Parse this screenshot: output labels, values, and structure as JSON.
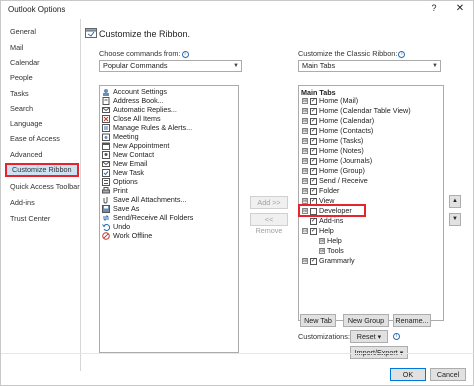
{
  "window": {
    "title": "Outlook Options",
    "help_glyph": "?",
    "close_glyph": "✕"
  },
  "sidebar": {
    "items": [
      {
        "label": "General"
      },
      {
        "label": "Mail"
      },
      {
        "label": "Calendar"
      },
      {
        "label": "People"
      },
      {
        "label": "Tasks"
      },
      {
        "label": "Search"
      },
      {
        "label": "Language"
      },
      {
        "label": "Ease of Access"
      },
      {
        "label": "Advanced"
      },
      {
        "label": "Customize Ribbon"
      },
      {
        "label": "Quick Access Toolbar"
      },
      {
        "label": "Add-ins"
      },
      {
        "label": "Trust Center"
      }
    ],
    "selected": "Customize Ribbon"
  },
  "main": {
    "heading": "Customize the Ribbon.",
    "left": {
      "label": "Choose commands from:",
      "select_value": "Popular Commands",
      "commands": [
        {
          "label": "Account Settings",
          "icon": "account-settings-icon"
        },
        {
          "label": "Address Book...",
          "icon": "address-book-icon"
        },
        {
          "label": "Automatic Replies...",
          "icon": "automatic-replies-icon"
        },
        {
          "label": "Close All Items",
          "icon": "close-all-items-icon"
        },
        {
          "label": "Manage Rules & Alerts...",
          "icon": "rules-icon"
        },
        {
          "label": "Meeting",
          "icon": "meeting-icon"
        },
        {
          "label": "New Appointment",
          "icon": "appointment-icon"
        },
        {
          "label": "New Contact",
          "icon": "contact-icon"
        },
        {
          "label": "New Email",
          "icon": "email-icon"
        },
        {
          "label": "New Task",
          "icon": "task-icon"
        },
        {
          "label": "Options",
          "icon": "options-icon"
        },
        {
          "label": "Print",
          "icon": "print-icon"
        },
        {
          "label": "Save All Attachments...",
          "icon": "attachments-icon"
        },
        {
          "label": "Save As",
          "icon": "save-as-icon"
        },
        {
          "label": "Send/Receive All Folders",
          "icon": "send-receive-icon"
        },
        {
          "label": "Undo",
          "icon": "undo-icon"
        },
        {
          "label": "Work Offline",
          "icon": "work-offline-icon"
        }
      ]
    },
    "middle": {
      "add_label": "Add >>",
      "remove_label": "<< Remove"
    },
    "right": {
      "label": "Customize the Classic Ribbon:",
      "select_value": "Main Tabs",
      "tree_header": "Main Tabs",
      "tabs": [
        {
          "label": "Home (Mail)",
          "checked": true,
          "expander": "⊞"
        },
        {
          "label": "Home (Calendar Table View)",
          "checked": true,
          "expander": "⊞"
        },
        {
          "label": "Home (Calendar)",
          "checked": true,
          "expander": "⊞"
        },
        {
          "label": "Home (Contacts)",
          "checked": true,
          "expander": "⊞"
        },
        {
          "label": "Home (Tasks)",
          "checked": true,
          "expander": "⊞"
        },
        {
          "label": "Home (Notes)",
          "checked": true,
          "expander": "⊞"
        },
        {
          "label": "Home (Journals)",
          "checked": true,
          "expander": "⊞"
        },
        {
          "label": "Home (Group)",
          "checked": true,
          "expander": "⊞"
        },
        {
          "label": "Send / Receive",
          "checked": true,
          "expander": "⊞"
        },
        {
          "label": "Folder",
          "checked": true,
          "expander": "⊞"
        },
        {
          "label": "View",
          "checked": true,
          "expander": "⊞"
        },
        {
          "label": "Developer",
          "checked": false,
          "expander": "⊞"
        },
        {
          "label": "Add-ins",
          "checked": true,
          "expander": ""
        },
        {
          "label": "Help",
          "checked": true,
          "expander": "⊟"
        },
        {
          "label": "Help",
          "checked": null,
          "expander": "⊞",
          "child": true
        },
        {
          "label": "Tools",
          "checked": null,
          "expander": "⊞",
          "child": true
        },
        {
          "label": "Grammarly",
          "checked": true,
          "expander": "⊞"
        }
      ],
      "new_tab_label": "New Tab",
      "new_group_label": "New Group",
      "rename_label": "Rename...",
      "customizations_label": "Customizations:",
      "reset_label": "Reset ▾",
      "import_export_label": "Import/Export ▾"
    }
  },
  "footer": {
    "ok_label": "OK",
    "cancel_label": "Cancel"
  },
  "colors": {
    "highlight_frame": "#e4252d",
    "selected_bg": "#cde3f4",
    "accent": "#0078d7"
  }
}
